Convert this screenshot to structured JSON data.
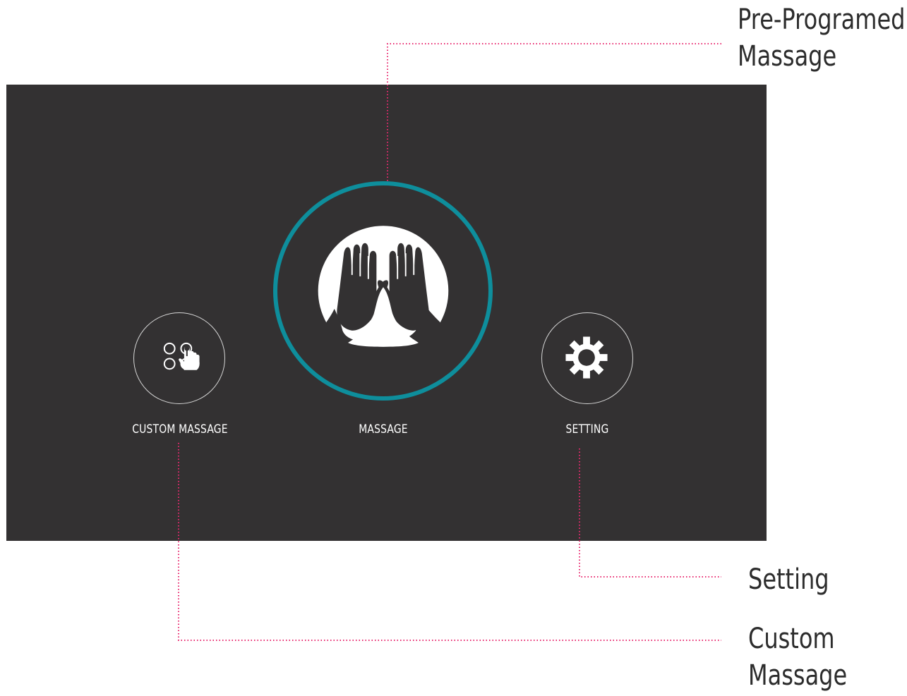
{
  "screen": {
    "buttons": {
      "custom_massage": {
        "label": "CUSTOM MASSAGE",
        "icon": "custom-massage-icon"
      },
      "massage": {
        "label": "MASSAGE",
        "icon": "massage-hands-icon"
      },
      "setting": {
        "label": "SETTING",
        "icon": "gear-icon"
      }
    }
  },
  "callouts": {
    "pre_programed": {
      "line1": "Pre-Programed",
      "line2": "Massage"
    },
    "setting": {
      "line1": "Setting"
    },
    "custom": {
      "line1": "Custom",
      "line2": "Massage"
    }
  },
  "colors": {
    "screen_bg": "#333132",
    "accent_ring": "#0e8e9c",
    "leader_line": "#e8296f",
    "icon": "#ffffff",
    "ring_border": "#d6d6d6"
  }
}
